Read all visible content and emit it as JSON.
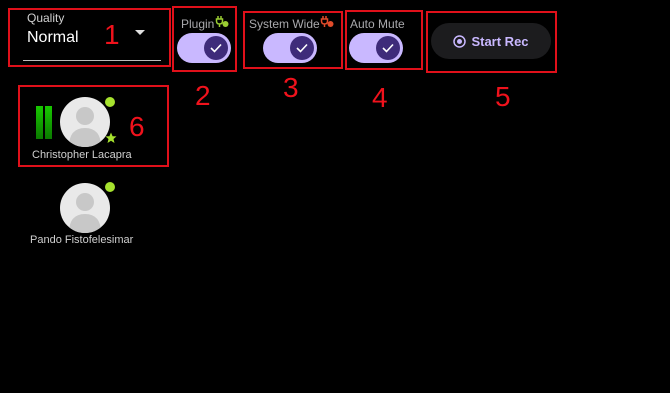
{
  "quality": {
    "label": "Quality",
    "value": "Normal"
  },
  "toggles": {
    "plugin": {
      "label": "Plugin",
      "checked": true
    },
    "system_wide": {
      "label": "System Wide",
      "checked": true
    },
    "auto_mute": {
      "label": "Auto Mute",
      "checked": true
    }
  },
  "record": {
    "label": "Start Rec"
  },
  "participants": [
    {
      "name": "Christopher Lacapra",
      "online": true,
      "speaking": true,
      "starred": true
    },
    {
      "name": "Pando Fistofelesimar",
      "online": true,
      "speaking": false,
      "starred": false
    }
  ],
  "callouts": [
    "1",
    "2",
    "3",
    "4",
    "5",
    "6"
  ],
  "colors": {
    "accent": "#c9b8ff",
    "knob": "#3e2b7a",
    "highlight": "#e0101a",
    "online": "#a6e22e",
    "plug_ok": "#9acd32",
    "plug_off": "#e04b2a"
  }
}
